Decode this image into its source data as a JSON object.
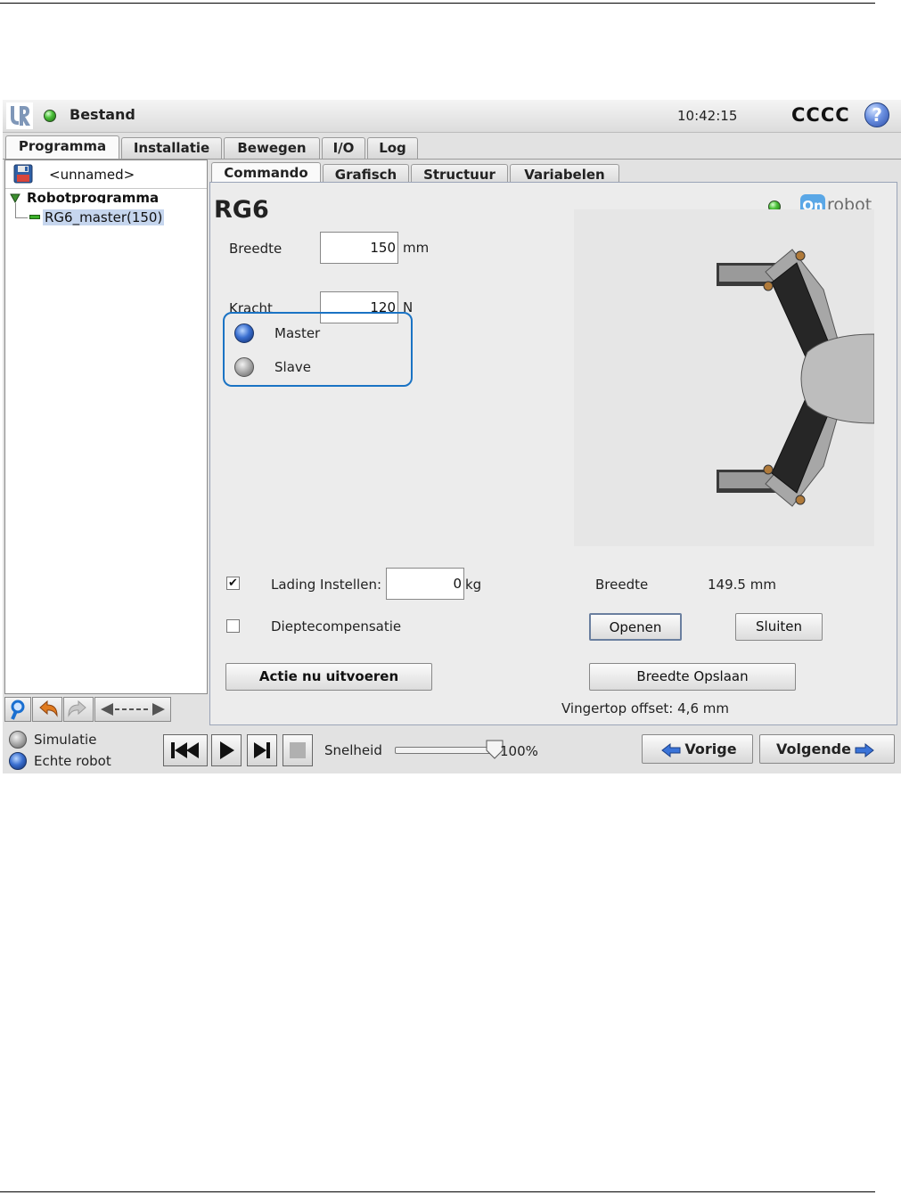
{
  "titlebar": {
    "menu_label": "Bestand",
    "time": "10:42:15",
    "robot_name": "CCCC",
    "help_glyph": "?"
  },
  "main_tabs": [
    {
      "label": "Programma",
      "active": true
    },
    {
      "label": "Installatie",
      "active": false
    },
    {
      "label": "Bewegen",
      "active": false
    },
    {
      "label": "I/O",
      "active": false
    },
    {
      "label": "Log",
      "active": false
    }
  ],
  "sub_tabs": [
    {
      "label": "Commando",
      "active": true
    },
    {
      "label": "Grafisch",
      "active": false
    },
    {
      "label": "Structuur",
      "active": false
    },
    {
      "label": "Variabelen",
      "active": false
    }
  ],
  "program": {
    "file_name": "<unnamed>",
    "tree_root": "Robotprogramma",
    "tree_node": "RG6_master(150)"
  },
  "rg6": {
    "title": "RG6",
    "brand_mark": "On",
    "brand_text": "robot",
    "width_label": "Breedte",
    "width_value": "150",
    "width_unit": "mm",
    "force_label": "Kracht",
    "force_value": "120",
    "force_unit": "N",
    "mode_master": "Master",
    "mode_slave": "Slave",
    "selected_mode": "Master",
    "payload_label": "Lading Instellen:",
    "payload_value": "0",
    "payload_unit": "kg",
    "payload_checked": true,
    "checkbox_mark": "✔",
    "depth_label": "Dieptecompensatie",
    "depth_checked": false,
    "current_width_label": "Breedte",
    "current_width_value": "149.5 mm",
    "open_button": "Openen",
    "close_button": "Sluiten",
    "run_button": "Actie nu uitvoeren",
    "save_width_button": "Breedte Opslaan",
    "fingertip_offset": "Vingertop offset: 4,6 mm"
  },
  "bottom": {
    "mode_simulation": "Simulatie",
    "mode_real": "Echte robot",
    "speed_label": "Snelheid",
    "speed_value": "100%",
    "speed_fraction": 1.0,
    "prev_button": "Vorige",
    "next_button": "Volgende"
  },
  "colors": {
    "accent_blue": "#1a73c4",
    "status_green": "#4cc23a",
    "selection": "#c6d6ee"
  }
}
